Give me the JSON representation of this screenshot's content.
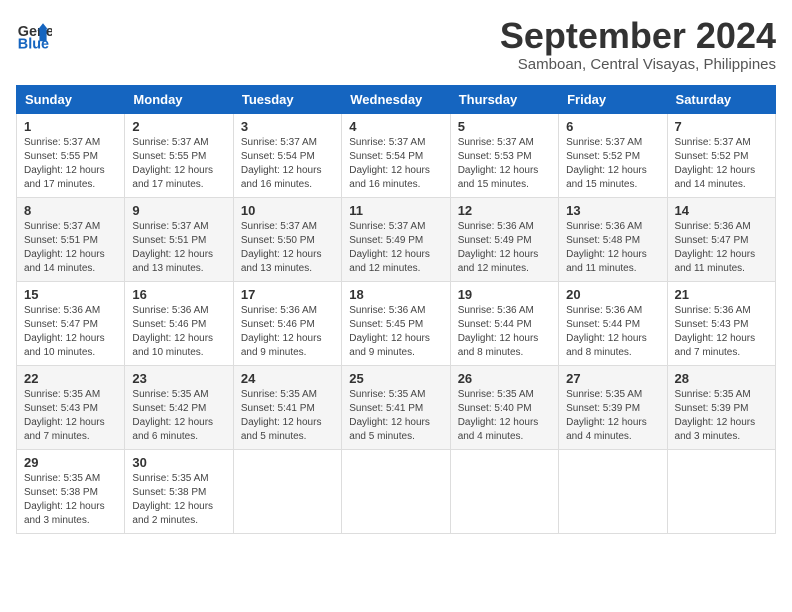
{
  "logo": {
    "line1": "General",
    "line2": "Blue"
  },
  "title": "September 2024",
  "subtitle": "Samboan, Central Visayas, Philippines",
  "weekdays": [
    "Sunday",
    "Monday",
    "Tuesday",
    "Wednesday",
    "Thursday",
    "Friday",
    "Saturday"
  ],
  "weeks": [
    [
      {
        "day": "1",
        "sunrise": "5:37 AM",
        "sunset": "5:55 PM",
        "daylight": "12 hours and 17 minutes."
      },
      {
        "day": "2",
        "sunrise": "5:37 AM",
        "sunset": "5:55 PM",
        "daylight": "12 hours and 17 minutes."
      },
      {
        "day": "3",
        "sunrise": "5:37 AM",
        "sunset": "5:54 PM",
        "daylight": "12 hours and 16 minutes."
      },
      {
        "day": "4",
        "sunrise": "5:37 AM",
        "sunset": "5:54 PM",
        "daylight": "12 hours and 16 minutes."
      },
      {
        "day": "5",
        "sunrise": "5:37 AM",
        "sunset": "5:53 PM",
        "daylight": "12 hours and 15 minutes."
      },
      {
        "day": "6",
        "sunrise": "5:37 AM",
        "sunset": "5:52 PM",
        "daylight": "12 hours and 15 minutes."
      },
      {
        "day": "7",
        "sunrise": "5:37 AM",
        "sunset": "5:52 PM",
        "daylight": "12 hours and 14 minutes."
      }
    ],
    [
      {
        "day": "8",
        "sunrise": "5:37 AM",
        "sunset": "5:51 PM",
        "daylight": "12 hours and 14 minutes."
      },
      {
        "day": "9",
        "sunrise": "5:37 AM",
        "sunset": "5:51 PM",
        "daylight": "12 hours and 13 minutes."
      },
      {
        "day": "10",
        "sunrise": "5:37 AM",
        "sunset": "5:50 PM",
        "daylight": "12 hours and 13 minutes."
      },
      {
        "day": "11",
        "sunrise": "5:37 AM",
        "sunset": "5:49 PM",
        "daylight": "12 hours and 12 minutes."
      },
      {
        "day": "12",
        "sunrise": "5:36 AM",
        "sunset": "5:49 PM",
        "daylight": "12 hours and 12 minutes."
      },
      {
        "day": "13",
        "sunrise": "5:36 AM",
        "sunset": "5:48 PM",
        "daylight": "12 hours and 11 minutes."
      },
      {
        "day": "14",
        "sunrise": "5:36 AM",
        "sunset": "5:47 PM",
        "daylight": "12 hours and 11 minutes."
      }
    ],
    [
      {
        "day": "15",
        "sunrise": "5:36 AM",
        "sunset": "5:47 PM",
        "daylight": "12 hours and 10 minutes."
      },
      {
        "day": "16",
        "sunrise": "5:36 AM",
        "sunset": "5:46 PM",
        "daylight": "12 hours and 10 minutes."
      },
      {
        "day": "17",
        "sunrise": "5:36 AM",
        "sunset": "5:46 PM",
        "daylight": "12 hours and 9 minutes."
      },
      {
        "day": "18",
        "sunrise": "5:36 AM",
        "sunset": "5:45 PM",
        "daylight": "12 hours and 9 minutes."
      },
      {
        "day": "19",
        "sunrise": "5:36 AM",
        "sunset": "5:44 PM",
        "daylight": "12 hours and 8 minutes."
      },
      {
        "day": "20",
        "sunrise": "5:36 AM",
        "sunset": "5:44 PM",
        "daylight": "12 hours and 8 minutes."
      },
      {
        "day": "21",
        "sunrise": "5:36 AM",
        "sunset": "5:43 PM",
        "daylight": "12 hours and 7 minutes."
      }
    ],
    [
      {
        "day": "22",
        "sunrise": "5:35 AM",
        "sunset": "5:43 PM",
        "daylight": "12 hours and 7 minutes."
      },
      {
        "day": "23",
        "sunrise": "5:35 AM",
        "sunset": "5:42 PM",
        "daylight": "12 hours and 6 minutes."
      },
      {
        "day": "24",
        "sunrise": "5:35 AM",
        "sunset": "5:41 PM",
        "daylight": "12 hours and 5 minutes."
      },
      {
        "day": "25",
        "sunrise": "5:35 AM",
        "sunset": "5:41 PM",
        "daylight": "12 hours and 5 minutes."
      },
      {
        "day": "26",
        "sunrise": "5:35 AM",
        "sunset": "5:40 PM",
        "daylight": "12 hours and 4 minutes."
      },
      {
        "day": "27",
        "sunrise": "5:35 AM",
        "sunset": "5:39 PM",
        "daylight": "12 hours and 4 minutes."
      },
      {
        "day": "28",
        "sunrise": "5:35 AM",
        "sunset": "5:39 PM",
        "daylight": "12 hours and 3 minutes."
      }
    ],
    [
      {
        "day": "29",
        "sunrise": "5:35 AM",
        "sunset": "5:38 PM",
        "daylight": "12 hours and 3 minutes."
      },
      {
        "day": "30",
        "sunrise": "5:35 AM",
        "sunset": "5:38 PM",
        "daylight": "12 hours and 2 minutes."
      },
      null,
      null,
      null,
      null,
      null
    ]
  ]
}
